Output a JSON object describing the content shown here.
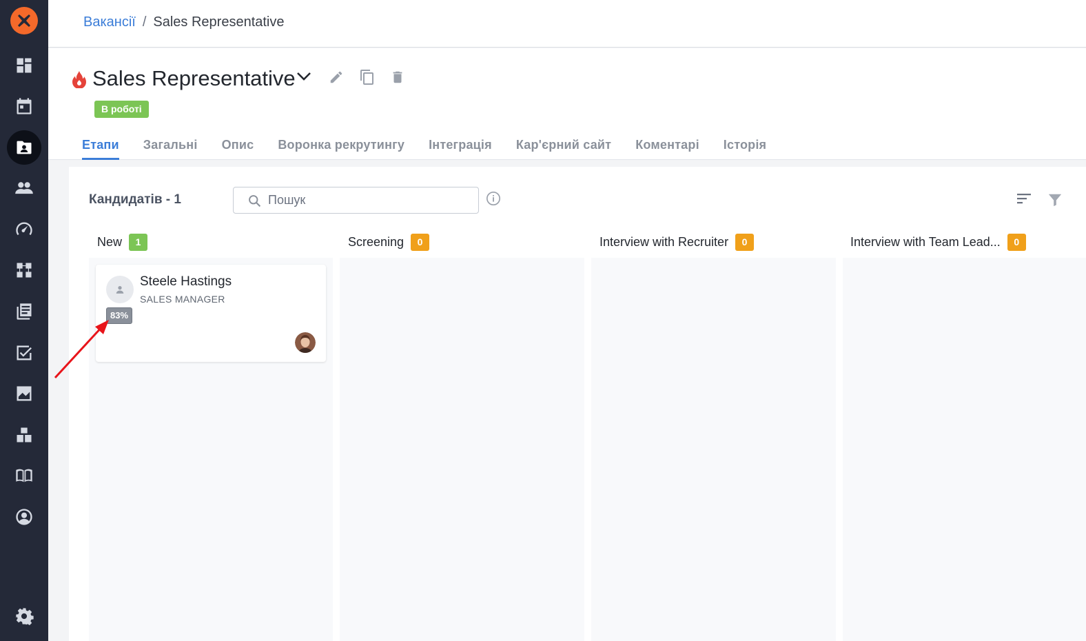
{
  "breadcrumb": {
    "parent": "Вакансії",
    "separator": "/",
    "current": "Sales Representative"
  },
  "job": {
    "title": "Sales Representative",
    "status": "В роботі"
  },
  "tabs": [
    {
      "label": "Етапи",
      "active": true
    },
    {
      "label": "Загальні"
    },
    {
      "label": "Опис"
    },
    {
      "label": "Воронка рекрутингу"
    },
    {
      "label": "Інтеграція"
    },
    {
      "label": "Кар'єрний сайт"
    },
    {
      "label": "Коментарі"
    },
    {
      "label": "Історія"
    }
  ],
  "board": {
    "count_label": "Кандидатів - 1",
    "search_placeholder": "Пошук",
    "columns": [
      {
        "title": "New",
        "count": "1"
      },
      {
        "title": "Screening",
        "count": "0"
      },
      {
        "title": "Interview with Recruiter",
        "count": "0"
      },
      {
        "title": "Interview with Team Lead...",
        "count": "0"
      }
    ],
    "candidate": {
      "name": "Steele Hastings",
      "role": "SALES MANAGER",
      "match": "83%"
    }
  },
  "colors": {
    "accent": "#3b7dd8",
    "sidebar": "#242938",
    "status_green": "#7cc555",
    "badge_orange": "#f0a01a",
    "logo": "#f4692a",
    "arrow": "#e8141a"
  },
  "sidebar": {
    "icons": [
      "dashboard-icon",
      "calendar-icon",
      "vacancies-icon",
      "candidates-icon",
      "speedometer-icon",
      "hierarchy-icon",
      "library-icon",
      "tasks-icon",
      "analytics-icon",
      "integrations-icon",
      "knowledge-base-icon",
      "profile-icon",
      "settings-icon"
    ]
  }
}
